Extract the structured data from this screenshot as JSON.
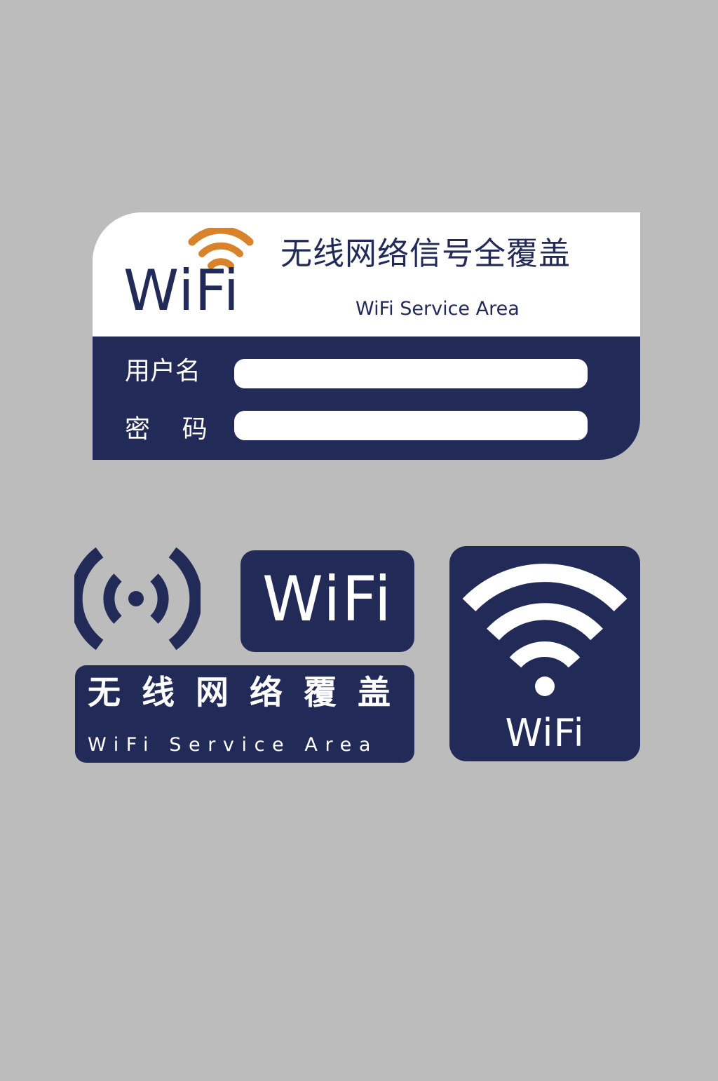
{
  "colors": {
    "background": "#bcbcbc",
    "navy": "#222b58",
    "orange_accent": "#d8822a",
    "white": "#ffffff"
  },
  "main_card": {
    "logo_text": "WiFi",
    "logo_icon": "wifi-signal-icon",
    "title": "无线网络信号全覆盖",
    "subtitle": "WiFi Service Area",
    "fields": [
      {
        "label": "用户名",
        "value": "",
        "placeholder": ""
      },
      {
        "label": "密    码",
        "value": "",
        "placeholder": ""
      }
    ]
  },
  "broadcast_icon": {
    "icon": "broadcast-signal-icon"
  },
  "wifi_badge": {
    "text": "WiFi"
  },
  "coverage_banner": {
    "title": "无线网络覆盖",
    "subtitle": "WiFi Service Area"
  },
  "square_sign": {
    "icon": "wifi-signal-icon",
    "text": "WiFi"
  }
}
